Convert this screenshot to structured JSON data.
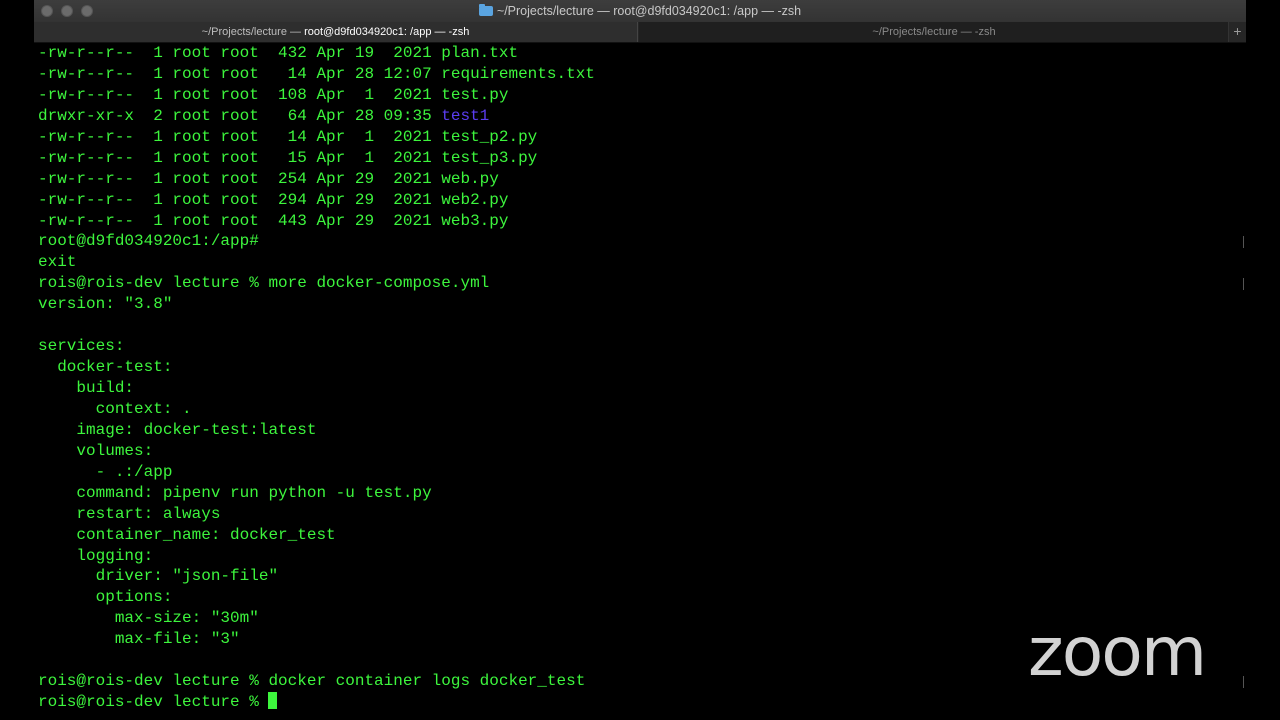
{
  "window": {
    "title": "~/Projects/lecture — root@d9fd034920c1: /app — -zsh",
    "tabs": [
      {
        "prefix": "~/Projects/lecture — ",
        "emphasis": "root@d9fd034920c1: /app — -zsh",
        "active": true
      },
      {
        "label": "~/Projects/lecture — -zsh",
        "active": false
      }
    ],
    "new_tab_label": "+"
  },
  "terminal": {
    "lines": [
      "-rw-r--r--  1 root root  432 Apr 19  2021 plan.txt",
      "-rw-r--r--  1 root root   14 Apr 28 12:07 requirements.txt",
      "-rw-r--r--  1 root root  108 Apr  1  2021 test.py",
      {
        "pre": "drwxr-xr-x  2 root root   64 Apr 28 09:35 ",
        "dir": "test1"
      },
      "-rw-r--r--  1 root root   14 Apr  1  2021 test_p2.py",
      "-rw-r--r--  1 root root   15 Apr  1  2021 test_p3.py",
      "-rw-r--r--  1 root root  254 Apr 29  2021 web.py",
      "-rw-r--r--  1 root root  294 Apr 29  2021 web2.py",
      "-rw-r--r--  1 root root  443 Apr 29  2021 web3.py",
      "root@d9fd034920c1:/app#",
      "exit",
      "rois@rois-dev lecture % more docker-compose.yml",
      "version: \"3.8\"",
      "",
      "services:",
      "  docker-test:",
      "    build:",
      "      context: .",
      "    image: docker-test:latest",
      "    volumes:",
      "      - .:/app",
      "    command: pipenv run python -u test.py",
      "    restart: always",
      "    container_name: docker_test",
      "    logging:",
      "      driver: \"json-file\"",
      "      options:",
      "        max-size: \"30m\"",
      "        max-file: \"3\"",
      "",
      "rois@rois-dev lecture % docker container logs docker_test"
    ],
    "prompt": "rois@rois-dev lecture % "
  },
  "overlay": {
    "logo_text": "zoom"
  },
  "colors": {
    "text": "#3df53d",
    "directory": "#5b3df0",
    "background": "#000000"
  }
}
